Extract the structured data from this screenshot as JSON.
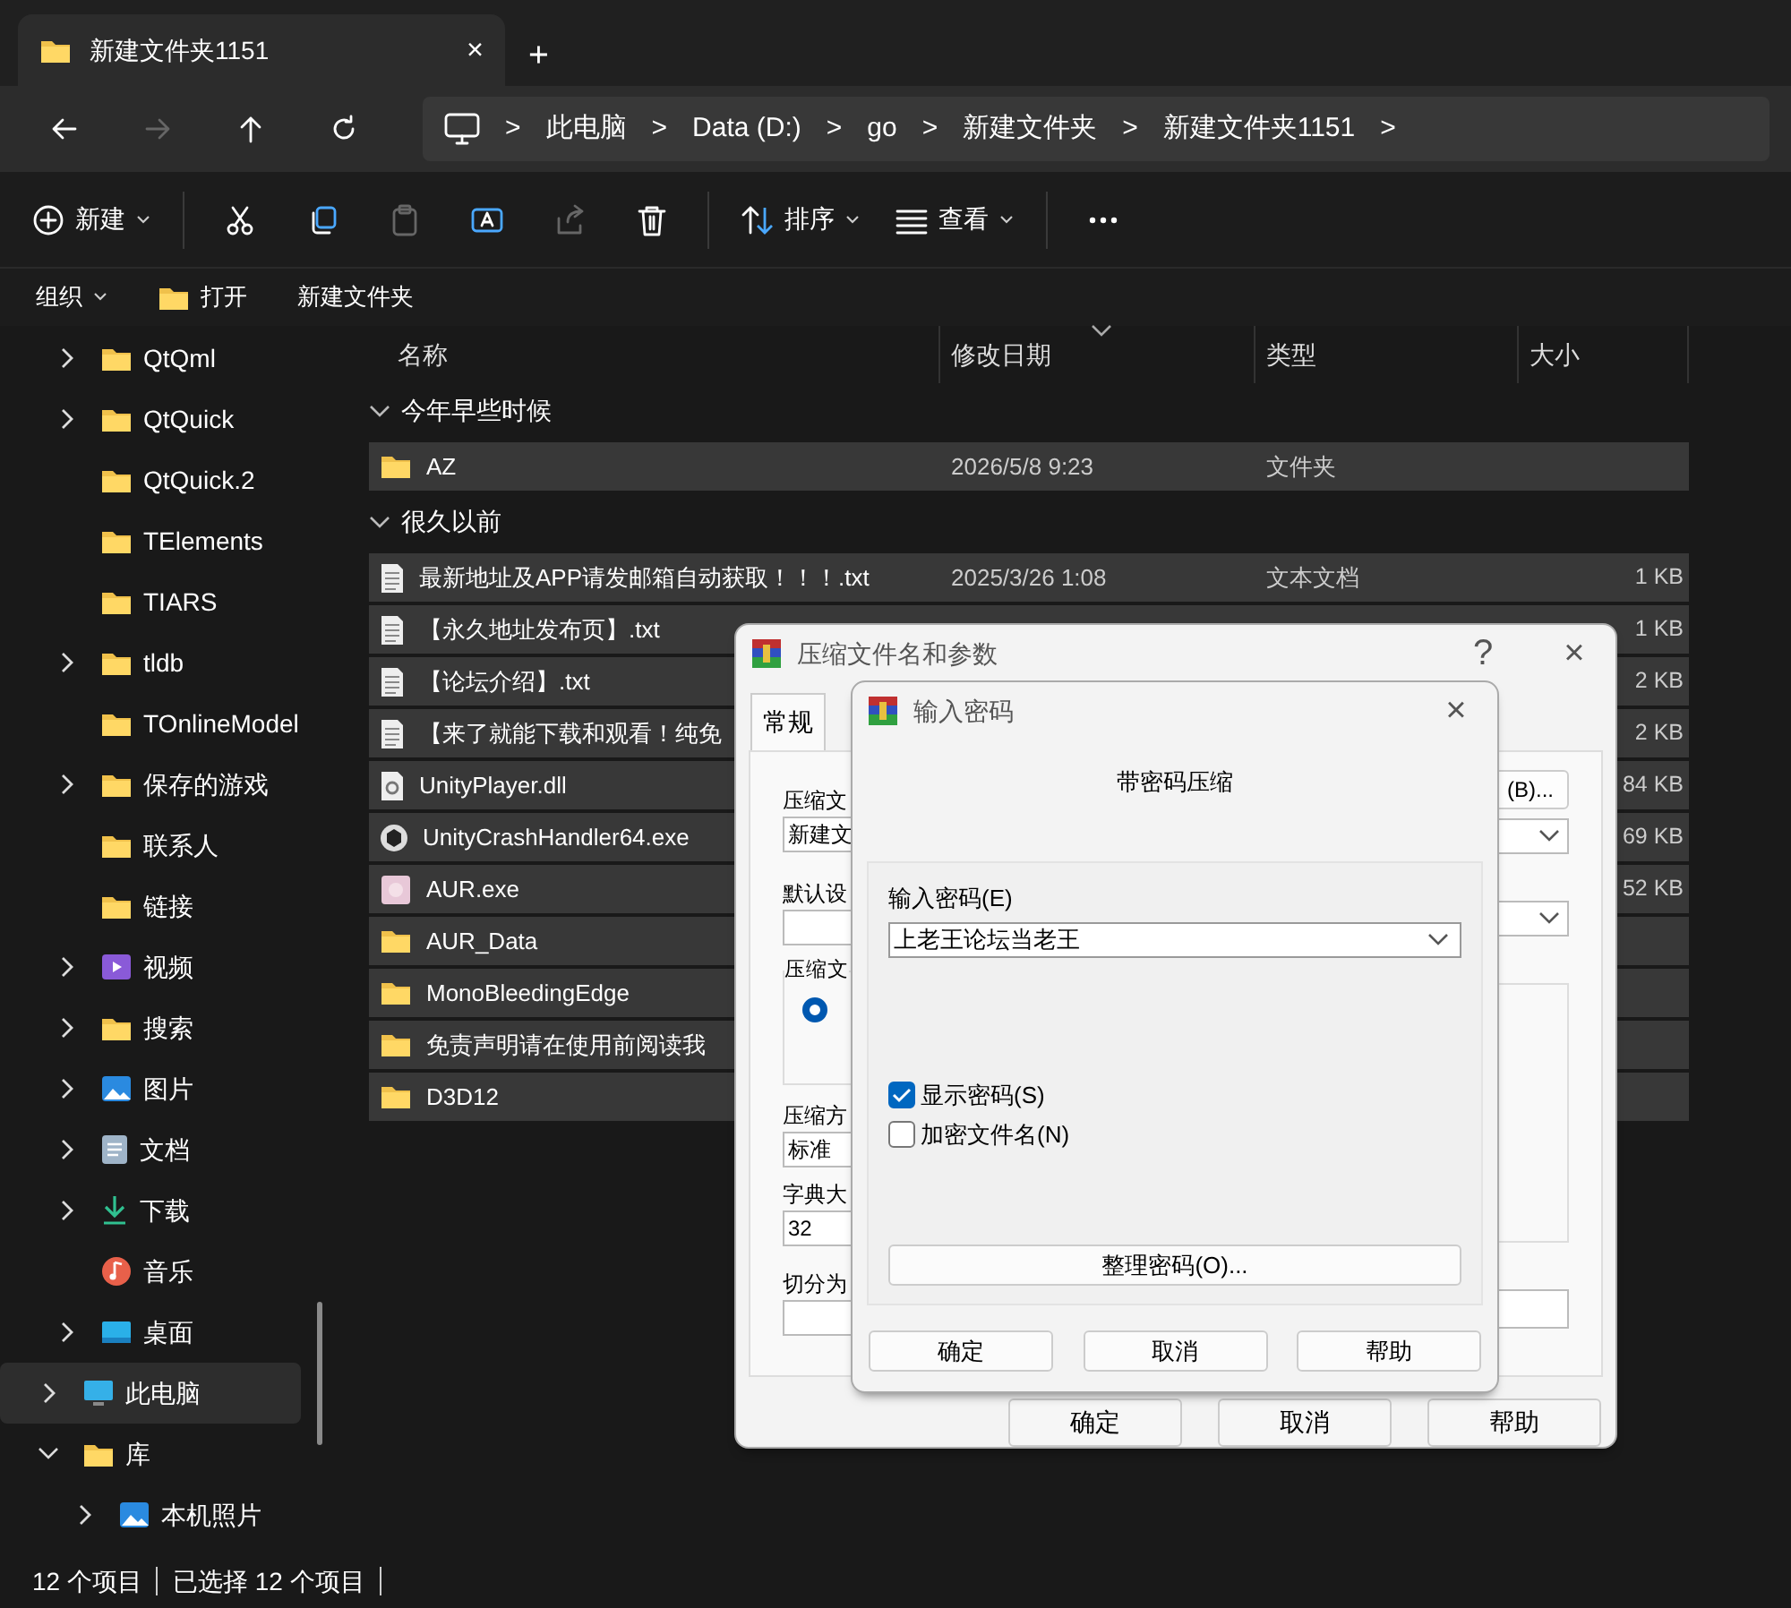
{
  "tab": {
    "title": "新建文件夹1151",
    "close": "×",
    "new": "+"
  },
  "nav": {
    "buttons": [
      {
        "kind": "back",
        "disabled": false
      },
      {
        "kind": "forward",
        "disabled": true
      },
      {
        "kind": "up",
        "disabled": false
      },
      {
        "kind": "refresh",
        "disabled": false
      }
    ],
    "breadcrumb": [
      "此电脑",
      "Data (D:)",
      "go",
      "新建文件夹",
      "新建文件夹1151"
    ],
    "separator": ">"
  },
  "commands": [
    {
      "kind": "new",
      "label": "新建",
      "dropdown": true,
      "disabled": false
    },
    {
      "kind": "cut",
      "dropdown": false,
      "disabled": false
    },
    {
      "kind": "copy",
      "dropdown": false,
      "disabled": false
    },
    {
      "kind": "paste",
      "dropdown": false,
      "disabled": true
    },
    {
      "kind": "rename",
      "dropdown": false,
      "disabled": false
    },
    {
      "kind": "share",
      "dropdown": false,
      "disabled": true
    },
    {
      "kind": "delete",
      "dropdown": false,
      "disabled": false
    },
    {
      "kind": "sort",
      "label": "排序",
      "dropdown": true,
      "disabled": false
    },
    {
      "kind": "view",
      "label": "查看",
      "dropdown": true,
      "disabled": false
    },
    {
      "kind": "more",
      "dropdown": false,
      "disabled": false
    }
  ],
  "secondary": [
    {
      "kind": "organize",
      "label": "组织",
      "dropdown": true
    },
    {
      "kind": "open",
      "label": "打开",
      "dropdown": false
    },
    {
      "kind": "plain",
      "label": "新建文件夹",
      "dropdown": false
    }
  ],
  "sidebar": {
    "scrolled_items": [
      {
        "label": "QtQml",
        "kind": "folder",
        "has_children": true,
        "selected": false
      },
      {
        "label": "QtQuick",
        "kind": "folder",
        "has_children": true,
        "selected": false
      },
      {
        "label": "QtQuick.2",
        "kind": "folder",
        "has_children": false,
        "selected": false
      },
      {
        "label": "TElements",
        "kind": "folder",
        "has_children": false,
        "selected": false
      },
      {
        "label": "TIARS",
        "kind": "folder",
        "has_children": false,
        "selected": false
      },
      {
        "label": "tldb",
        "kind": "folder",
        "has_children": true,
        "selected": false
      },
      {
        "label": "TOnlineModel",
        "kind": "folder",
        "has_children": false,
        "selected": false
      },
      {
        "label": "保存的游戏",
        "kind": "folder",
        "has_children": true,
        "selected": false
      },
      {
        "label": "联系人",
        "kind": "folder",
        "has_children": false,
        "selected": false
      },
      {
        "label": "链接",
        "kind": "folder",
        "has_children": false,
        "selected": false
      },
      {
        "label": "视频",
        "kind": "video",
        "has_children": true,
        "selected": false
      },
      {
        "label": "搜索",
        "kind": "folder",
        "has_children": true,
        "selected": false
      },
      {
        "label": "图片",
        "kind": "pictures",
        "has_children": true,
        "selected": false
      },
      {
        "label": "文档",
        "kind": "documents",
        "has_children": true,
        "selected": false
      },
      {
        "label": "下载",
        "kind": "downloads",
        "has_children": true,
        "selected": false
      },
      {
        "label": "音乐",
        "kind": "music",
        "has_children": false,
        "selected": false
      },
      {
        "label": "桌面",
        "kind": "desktop",
        "has_children": true,
        "selected": false
      }
    ],
    "items": [
      {
        "label": "此电脑",
        "kind": "pc",
        "has_children": true,
        "expanded": false,
        "selected": true
      },
      {
        "label": "库",
        "kind": "folder",
        "has_children": true,
        "expanded": true,
        "selected": false,
        "children": [
          {
            "label": "本机照片",
            "kind": "pictures",
            "has_children": true,
            "expanded": false,
            "selected": false
          }
        ]
      }
    ]
  },
  "list": {
    "columns": [
      "名称",
      "修改日期",
      "类型",
      "大小"
    ],
    "groups": [
      {
        "label": "今年早些时候",
        "expanded": true,
        "rows": [
          {
            "name": "AZ",
            "kind": "folder",
            "date": "2026/5/8 9:23",
            "type": "文件夹",
            "selected": true
          }
        ]
      },
      {
        "label": "很久以前",
        "expanded": true,
        "rows": [
          {
            "name": "最新地址及APP请发邮箱自动获取！！！.txt",
            "kind": "text",
            "date": "2025/3/26 1:08",
            "type": "文本文档",
            "size": "1 KB",
            "selected": true
          },
          {
            "name": "【永久地址发布页】.txt",
            "kind": "text",
            "size": "1 KB",
            "selected": true
          },
          {
            "name": "【论坛介绍】.txt",
            "kind": "text",
            "size": "2 KB",
            "selected": true
          },
          {
            "name": "【来了就能下载和观看！纯免",
            "kind": "text",
            "size": "2 KB",
            "selected": true
          },
          {
            "name": "UnityPlayer.dll",
            "kind": "dll",
            "size": "84 KB",
            "selected": true
          },
          {
            "name": "UnityCrashHandler64.exe",
            "kind": "unity",
            "size": "69 KB",
            "selected": true
          },
          {
            "name": "AUR.exe",
            "kind": "app",
            "size": "52 KB",
            "selected": true
          },
          {
            "name": "AUR_Data",
            "kind": "folder",
            "selected": true
          },
          {
            "name": "MonoBleedingEdge",
            "kind": "folder",
            "selected": true
          },
          {
            "name": "免责声明请在使用前阅读我",
            "kind": "folder",
            "selected": true
          },
          {
            "name": "D3D12",
            "kind": "folder",
            "selected": true
          }
        ]
      }
    ]
  },
  "status_bar": [
    "12 个项目",
    "已选择 12 个项目"
  ],
  "archive_dialog": {
    "title": "压缩文件名和参数",
    "help": "?",
    "close": "×",
    "tabs": [
      {
        "label": "常规",
        "selected": true
      }
    ],
    "fields": [
      {
        "label": "压缩文",
        "value": "新建文"
      },
      {
        "label": "默认设"
      }
    ],
    "group": {
      "label": "压缩文",
      "radio_selected": true
    },
    "fields2": [
      {
        "label": "压缩方",
        "value": "标准"
      },
      {
        "label": "字典大",
        "value": "32"
      },
      {
        "label": "切分为"
      }
    ],
    "browse_button": "(B)...",
    "buttons": [
      "确定",
      "取消",
      "帮助"
    ]
  },
  "password_dialog": {
    "title": "输入密码",
    "close": "×",
    "heading": "带密码压缩",
    "password_label": "输入密码(E)",
    "password_value": "上老王论坛当老王",
    "checkboxes": [
      {
        "label": "显示密码(S)",
        "checked": true
      },
      {
        "label": "加密文件名(N)",
        "checked": false
      }
    ],
    "organize_button": "整理密码(O)...",
    "buttons": [
      "确定",
      "取消",
      "帮助"
    ]
  }
}
